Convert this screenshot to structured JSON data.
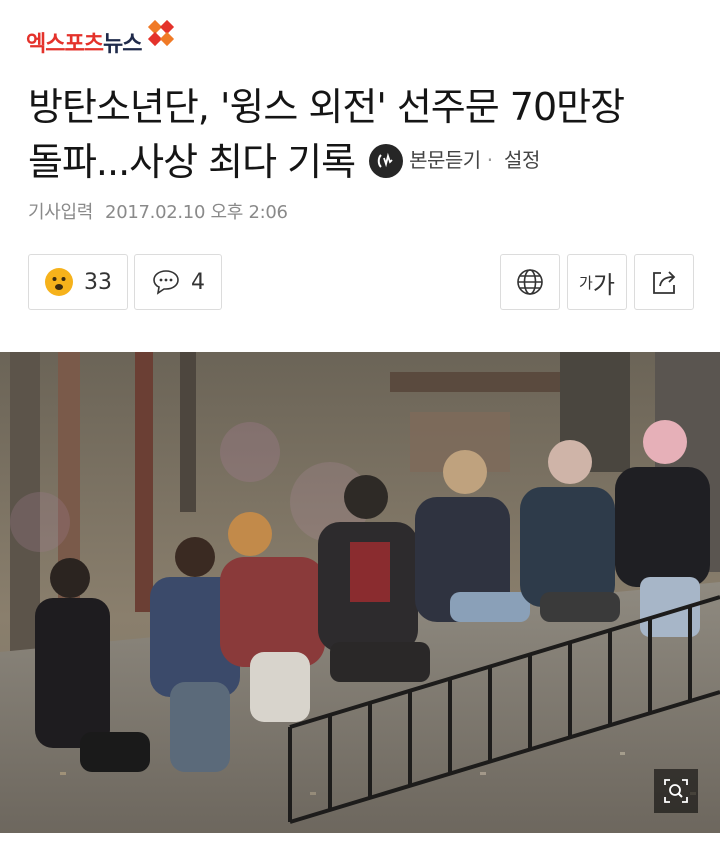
{
  "header": {
    "logo_text_red": "엑스포츠",
    "logo_text_dark": "뉴스"
  },
  "article": {
    "headline_line1": "방탄소년단, '윙스 외전' 선주문 70만장",
    "headline_line2": "돌파...사상 최다 기록",
    "listen_label": "본문듣기",
    "separator": "·",
    "settings_label": "설정",
    "date_label": "기사입력",
    "date_value": "2017.02.10 오후 2:06"
  },
  "actions": {
    "like_count": "33",
    "comment_count": "4",
    "font_small": "가",
    "font_big": "가"
  },
  "colors": {
    "brand_red": "#e4322b",
    "brand_orange": "#f07a26",
    "brand_dark": "#1f2a4a"
  },
  "icons": [
    "smiley-icon",
    "comment-icon",
    "globe-icon",
    "share-icon",
    "zoom-icon",
    "listen-icon"
  ]
}
